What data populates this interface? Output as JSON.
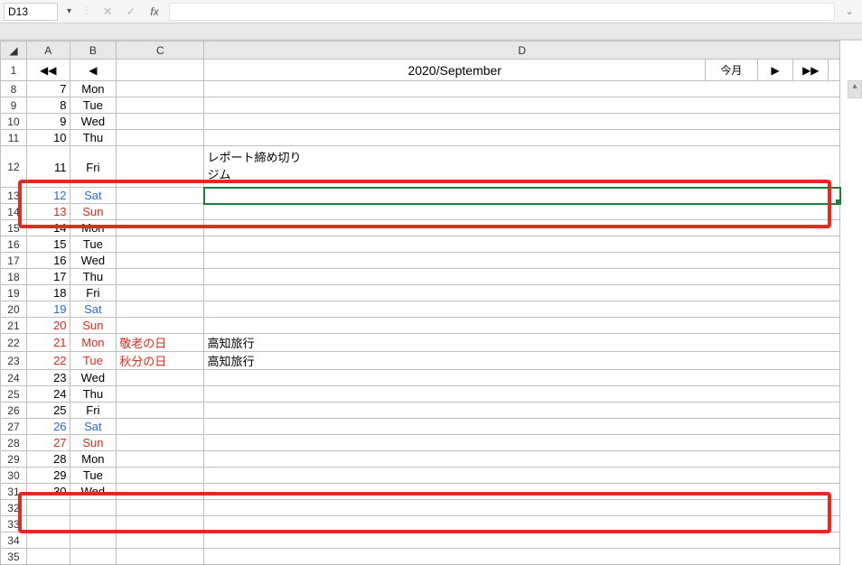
{
  "nameBox": "D13",
  "formulaBar": {
    "cancel": "✕",
    "confirm": "✓",
    "fx": "fx",
    "value": ""
  },
  "columns": [
    "A",
    "B",
    "C",
    "D"
  ],
  "title": "2020/September",
  "nav": {
    "first": "◀◀",
    "prev": "◀",
    "today": "今月",
    "next": "▶",
    "last": "▶▶"
  },
  "rows": [
    {
      "r": 8,
      "day": 7,
      "dow": "Mon"
    },
    {
      "r": 9,
      "day": 8,
      "dow": "Tue"
    },
    {
      "r": 10,
      "day": 9,
      "dow": "Wed"
    },
    {
      "r": 11,
      "day": 10,
      "dow": "Thu"
    },
    {
      "r": 12,
      "day": 11,
      "dow": "Fri",
      "tall": true,
      "d": "レポート締め切り\nジム"
    },
    {
      "r": 13,
      "day": 12,
      "dow": "Sat",
      "cls": "blue",
      "sel": true
    },
    {
      "r": 14,
      "day": 13,
      "dow": "Sun",
      "cls": "red"
    },
    {
      "r": 15,
      "day": 14,
      "dow": "Mon"
    },
    {
      "r": 16,
      "day": 15,
      "dow": "Tue"
    },
    {
      "r": 17,
      "day": 16,
      "dow": "Wed"
    },
    {
      "r": 18,
      "day": 17,
      "dow": "Thu"
    },
    {
      "r": 19,
      "day": 18,
      "dow": "Fri"
    },
    {
      "r": 20,
      "day": 19,
      "dow": "Sat",
      "cls": "blue"
    },
    {
      "r": 21,
      "day": 20,
      "dow": "Sun",
      "cls": "red"
    },
    {
      "r": 22,
      "day": 21,
      "dow": "Mon",
      "cls": "red",
      "c": "敬老の日",
      "d": "高知旅行"
    },
    {
      "r": 23,
      "day": 22,
      "dow": "Tue",
      "cls": "red",
      "c": "秋分の日",
      "d": "高知旅行"
    },
    {
      "r": 24,
      "day": 23,
      "dow": "Wed"
    },
    {
      "r": 25,
      "day": 24,
      "dow": "Thu"
    },
    {
      "r": 26,
      "day": 25,
      "dow": "Fri"
    },
    {
      "r": 27,
      "day": 26,
      "dow": "Sat",
      "cls": "blue"
    },
    {
      "r": 28,
      "day": 27,
      "dow": "Sun",
      "cls": "red"
    },
    {
      "r": 29,
      "day": 28,
      "dow": "Mon"
    },
    {
      "r": 30,
      "day": 29,
      "dow": "Tue"
    },
    {
      "r": 31,
      "day": 30,
      "dow": "Wed"
    }
  ],
  "tailRows": [
    32,
    33,
    34,
    35
  ],
  "holidayTextClass": "red"
}
